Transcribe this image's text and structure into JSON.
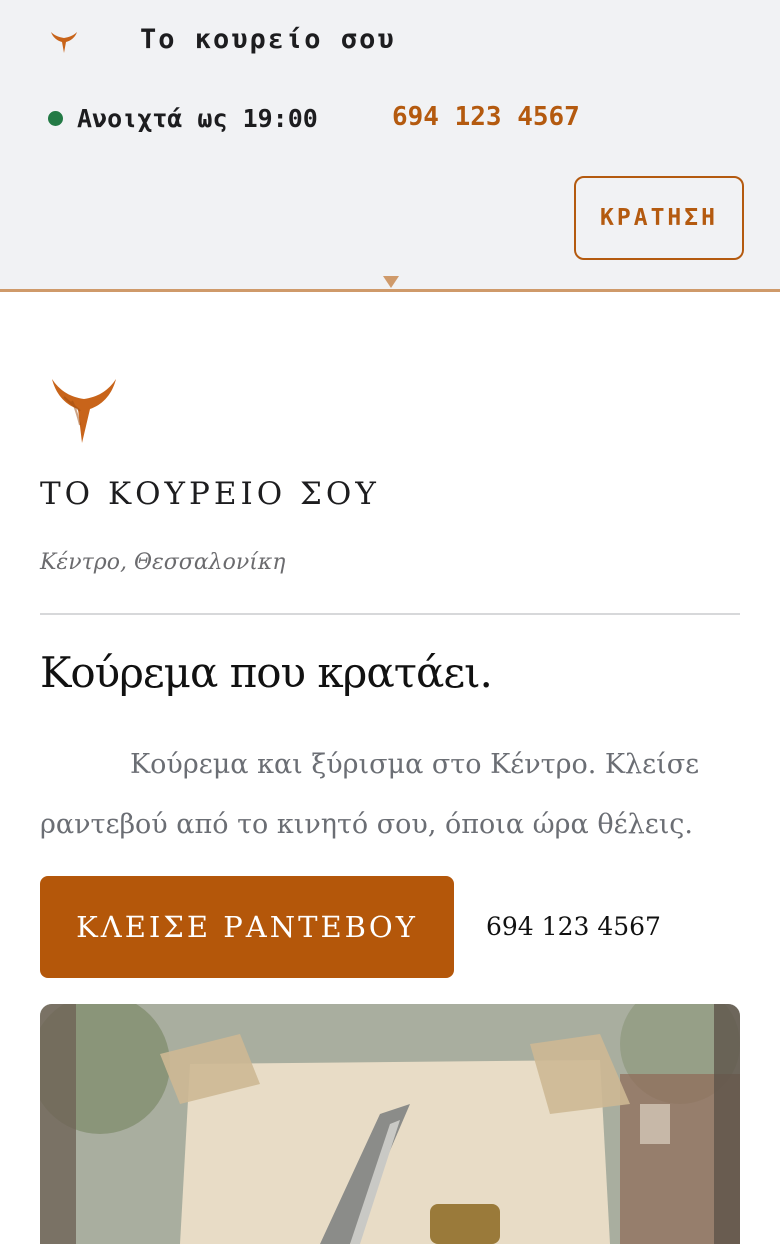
{
  "header": {
    "site_name": "Το κουρείο σου",
    "status_text": "Ανοιχτά ως 19:00",
    "phone": "694 123 4567",
    "book_label": "ΚΡΑΤΗΣΗ",
    "status_color": "#237a45",
    "accent": "#b45a0f"
  },
  "hero": {
    "brand": "ΤΟ ΚΟΥΡΕΙΟ ΣΟΥ",
    "location": "Κέντρο, Θεσσαλονίκη",
    "headline": "Κούρεμα που κρατάει.",
    "lede": "Κούρεμα και ξύρισμα στο Κέντρο. Κλείσε ραντεβού από το κινητό σου, όποια ώρα θέλεις.",
    "cta_label": "ΚΛΕΙΣΕ ΡΑΝΤΕΒΟΥ",
    "cta_phone": "694 123 4567",
    "cta_color": "#b4570a"
  },
  "icons": [
    "horn-logo-icon",
    "status-dot-icon"
  ]
}
